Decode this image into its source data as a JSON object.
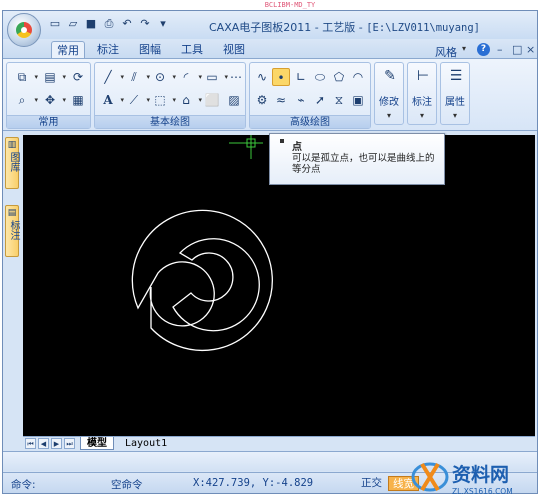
{
  "watermark_top": "BCLIBM-MD_TY",
  "window": {
    "title": "CAXA电子图板2011 - 工艺版 - ",
    "path": "[E:\\LZV011\\muyang]",
    "controls": [
      "–",
      "□",
      "×"
    ]
  },
  "tabs": [
    {
      "label": "常用",
      "active": true
    },
    {
      "label": "标注",
      "active": false
    },
    {
      "label": "图幅",
      "active": false
    },
    {
      "label": "工具",
      "active": false
    },
    {
      "label": "视图",
      "active": false
    }
  ],
  "style_label": "风格",
  "help_icon": "?",
  "ribbon": {
    "groups": [
      {
        "label": "常用"
      },
      {
        "label": "基本绘图"
      },
      {
        "label": "高级绘图"
      }
    ],
    "big_buttons": [
      {
        "label": "修改",
        "icon": "eraser-icon"
      },
      {
        "label": "标注",
        "icon": "dimension-icon"
      },
      {
        "label": "属性",
        "icon": "properties-icon"
      }
    ],
    "text_tool": "A"
  },
  "side_tabs": [
    {
      "label": "图库"
    },
    {
      "label": "标注"
    }
  ],
  "tooltip": {
    "title": "点",
    "body": "可以是孤立点，也可以是曲线上的等分点"
  },
  "layout_tabs": [
    {
      "label": "模型",
      "active": true
    },
    {
      "label": "Layout1",
      "active": false
    }
  ],
  "status": {
    "command_label": "命令:",
    "command_state": "空命令",
    "coordinates": "X:427.739, Y:-4.829",
    "ortho": "正交",
    "lineweight": "线宽"
  },
  "logo": {
    "brand": "资料网",
    "url": "ZL.XS1616.COM"
  },
  "colors": {
    "canvas": "#000000",
    "ribbon_blue": "#d6e4f5",
    "accent_orange": "#f7b24a"
  }
}
